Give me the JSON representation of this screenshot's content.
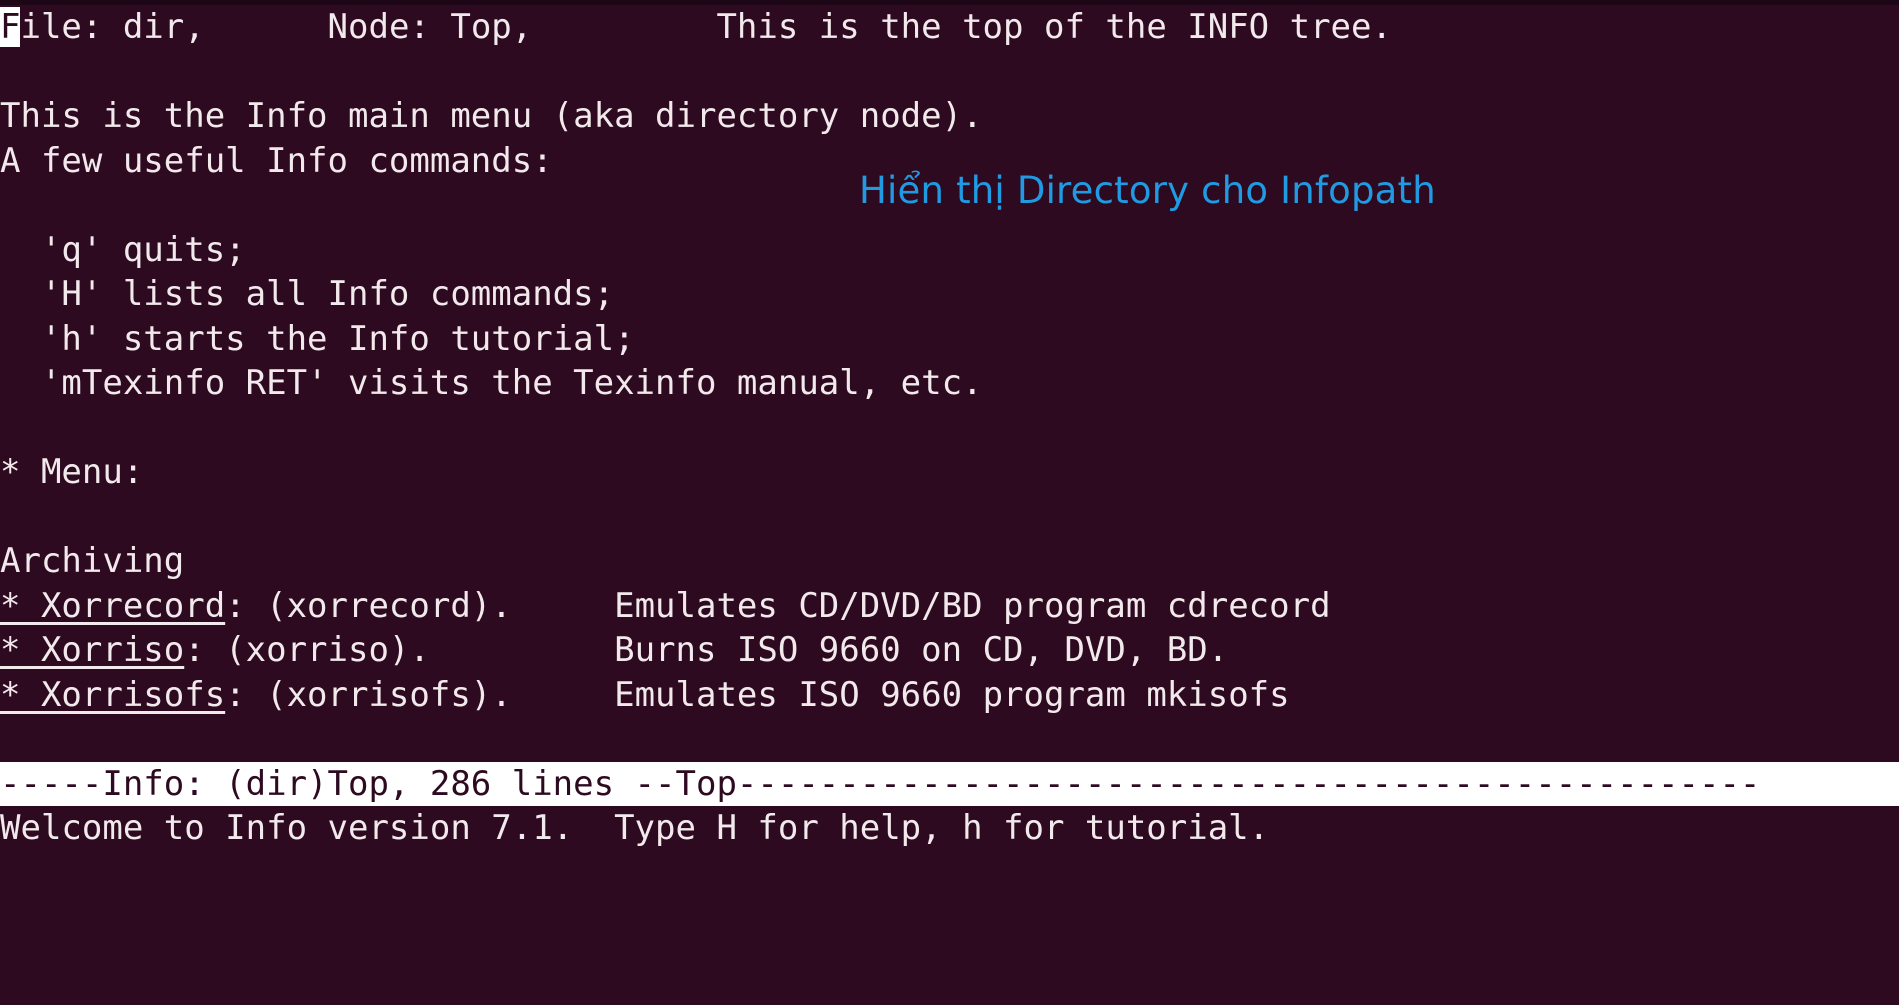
{
  "terminal": {
    "colors": {
      "background": "#2d0a20",
      "foreground": "#f2e9ec",
      "cursor_bg": "#ffffff",
      "cursor_fg": "#2d0a20",
      "statusbar_bg": "#ffffff",
      "statusbar_fg": "#2d0a20",
      "annotation": "#1f9ae3"
    }
  },
  "header": {
    "cursor_char": "F",
    "rest": "ile: dir,\tNode: Top,\tThis is the top of the INFO tree.",
    "full_text": "File: dir,      Node: Top,         This is the top of the INFO tree."
  },
  "intro": {
    "line1": "This is the Info main menu (aka directory node).",
    "line2": "A few useful Info commands:"
  },
  "commands": [
    "  'q' quits;",
    "  'H' lists all Info commands;",
    "  'h' starts the Info tutorial;",
    "  'mTexinfo RET' visits the Texinfo manual, etc."
  ],
  "menu": {
    "heading": "* Menu:",
    "section": "Archiving",
    "entries": [
      {
        "link": "* Xorrecord",
        "target": ": (xorrecord).",
        "description": "Emulates CD/DVD/BD program cdrecord"
      },
      {
        "link": "* Xorriso",
        "target": ": (xorriso).",
        "description": "Burns ISO 9660 on CD, DVD, BD."
      },
      {
        "link": "* Xorrisofs",
        "target": ": (xorrisofs).",
        "description": "Emulates ISO 9660 program mkisofs"
      }
    ]
  },
  "statusbar": {
    "text": "-----Info: (dir)Top, 286 lines --Top--------------------------------------------------"
  },
  "echo_area": {
    "text": "Welcome to Info version 7.1.  Type H for help, h for tutorial."
  },
  "annotation": {
    "text": "Hiển thị Directory cho Infopath"
  }
}
